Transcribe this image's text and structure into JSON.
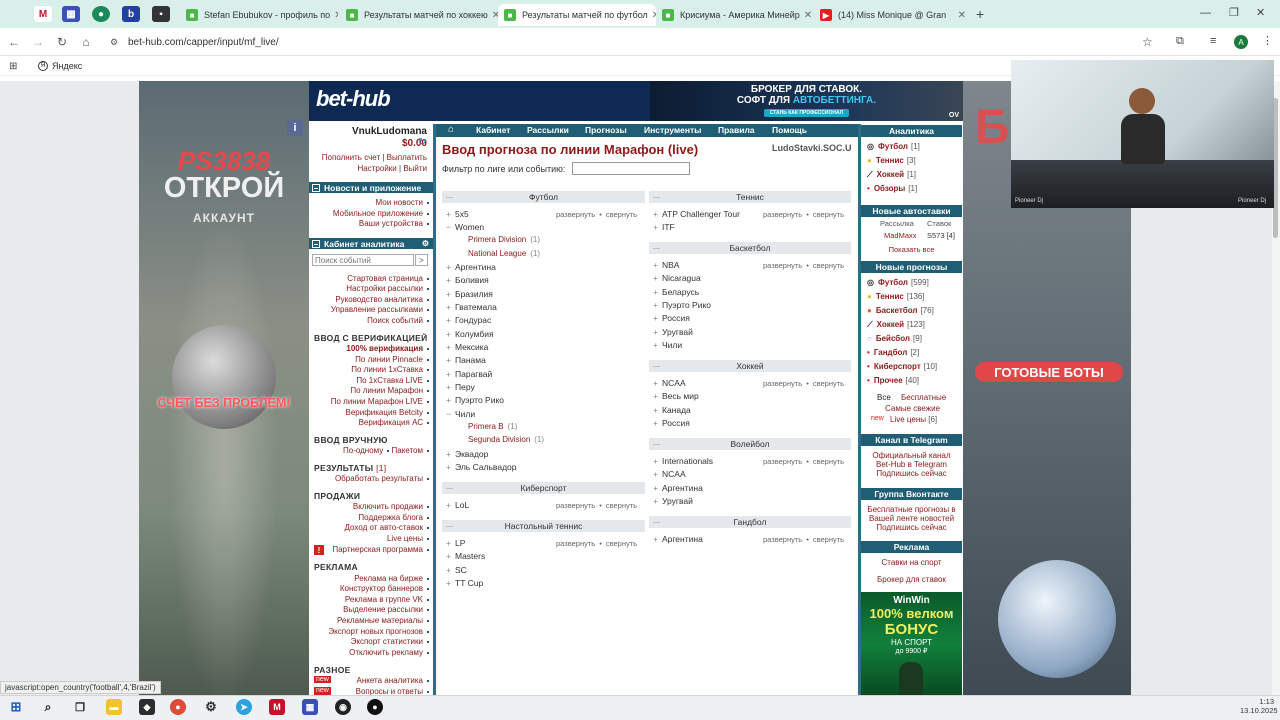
{
  "browser": {
    "pinned": [
      {
        "icon": "mail-ru-icon",
        "label": "M",
        "color": "#c8102e"
      },
      {
        "icon": "grid-app-icon",
        "label": "▦",
        "color": "#3a4fb8"
      },
      {
        "icon": "green-circle-icon",
        "label": "●",
        "color": "#1a8a5a"
      },
      {
        "icon": "b-app-icon",
        "label": "b",
        "color": "#2340a0"
      },
      {
        "icon": "dark-app-icon",
        "label": "▪",
        "color": "#333333"
      }
    ],
    "tabs": [
      {
        "title": "Stefan Ebubukov - профиль по",
        "active": false,
        "fav_color": "#4cb848"
      },
      {
        "title": "Результаты матчей по хоккею",
        "active": false,
        "fav_color": "#4cb848"
      },
      {
        "title": "Результаты матчей по футбол",
        "active": true,
        "fav_color": "#4cb848"
      },
      {
        "title": "Крисиума - Америка Минейр",
        "active": false,
        "fav_color": "#4cb848"
      },
      {
        "title": "(14) Miss Monique @ Gran",
        "active": false,
        "fav_color": "#e02020"
      }
    ],
    "url": "bet-hub.com/capper/input/mf_live/",
    "bookmark": "Яндекс",
    "profile_letter": "A"
  },
  "promo_left": {
    "brand": "PS3838",
    "open": "ОТКРОЙ",
    "account": "АККАУНТ",
    "slogan": "СЧЕТ БЕЗ ПРОБЛЕМ!"
  },
  "promo_right": {
    "letters": "Б",
    "bots": "ГОТОВЫЕ БОТЫ"
  },
  "header": {
    "logo": "bet-hub",
    "banner_line1": "БРОКЕР ДЛЯ СТАВОК.",
    "banner_line2": "СОФТ ДЛЯ",
    "banner_highlight": "АВТОБЕТТИНГА.",
    "banner_button": "СТАНЬ КАК ПРОФЕССИОНАЛ",
    "banner_corner": "OV"
  },
  "user": {
    "name": "VnukLudomana",
    "balance": "$0.00",
    "topup": "Пополнить счет",
    "withdraw": "Выплатить",
    "settings": "Настройки",
    "logout": "Выйти",
    "sep": "|"
  },
  "left": {
    "news_header": "Новости и приложение",
    "news_links": [
      "Мои новости",
      "Мобильное приложение",
      "Ваши устройства"
    ],
    "cabinet_header": "Кабинет аналитика",
    "search_placeholder": "Поиск событий",
    "cabinet_links": [
      "Стартовая страница",
      "Настройки рассылки",
      "Руководство аналитика",
      "Управление рассылками",
      "Поиск событий"
    ],
    "verif_title": "ВВОД С ВЕРИФИКАЦИЕЙ",
    "verif_links": [
      "100% верификация",
      "По линии Pinnacle",
      "По линии 1хСтавка",
      "По 1хСтавка LIVE",
      "По линии Марафон",
      "По линии Марафон LIVE",
      "Верификация Betcity",
      "Верификация АС"
    ],
    "manual_title": "ВВОД ВРУЧНУЮ",
    "manual_link1": "По-одному",
    "manual_link2": "Пакетом",
    "results_title": "РЕЗУЛЬТАТЫ",
    "results_count": "[1]",
    "results_link": "Обработать результаты",
    "sales_title": "ПРОДАЖИ",
    "sales_links": [
      "Включить продажи",
      "Поддержка блога",
      "Доход от авто-ставок",
      "Live цены",
      "Партнерская программа"
    ],
    "ads_title": "РЕКЛАМА",
    "ads_links": [
      "Реклама на бирже",
      "Конструктор баннеров",
      "Реклама в группе VK",
      "Выделение рассылки",
      "Рекламные материалы",
      "Экспорт новых прогнозов",
      "Экспорт статистики",
      "Отключить рекламу"
    ],
    "misc_title": "РАЗНОЕ",
    "misc_links": [
      "Анкета аналитика",
      "Вопросы и ответы"
    ],
    "new_badge": "new"
  },
  "nav": {
    "items": [
      "Кабинет",
      "Рассылки",
      "Прогнозы",
      "Инструменты",
      "Правила",
      "Помощь"
    ]
  },
  "content": {
    "title": "Ввод прогноза по линии Марафон (live)",
    "site": "LudoStavki.SOC.U",
    "filter_label": "Фильтр по лиге или событию:",
    "expand": "развернуть",
    "collapse": "свернуть",
    "bullet": "•",
    "football_header": "Футбол",
    "football": [
      {
        "name": "5х5",
        "sign": "+",
        "actions": true
      },
      {
        "name": "Women",
        "sign": "−",
        "actions": false
      },
      {
        "name": "Argентина",
        "sign": "+",
        "actions": false
      },
      {
        "name": "Боливия",
        "sign": "+",
        "actions": false
      },
      {
        "name": "Бразилия",
        "sign": "+",
        "actions": false
      },
      {
        "name": "Гватемала",
        "sign": "+",
        "actions": false
      },
      {
        "name": "Гондурас",
        "sign": "+",
        "actions": false
      },
      {
        "name": "Колумбия",
        "sign": "+",
        "actions": false
      },
      {
        "name": "Мексика",
        "sign": "+",
        "actions": false
      },
      {
        "name": "Панама",
        "sign": "+",
        "actions": false
      },
      {
        "name": "Парагвай",
        "sign": "+",
        "actions": false
      },
      {
        "name": "Перу",
        "sign": "+",
        "actions": false
      },
      {
        "name": "Пуэрто Рико",
        "sign": "+",
        "actions": false
      },
      {
        "name": "Чили",
        "sign": "−",
        "actions": false
      },
      {
        "name": "Эквадор",
        "sign": "+",
        "actions": false
      },
      {
        "name": "Эль Сальвадор",
        "sign": "+",
        "actions": false
      }
    ],
    "women_subs": [
      {
        "name": "Primera Division",
        "count": "(1)"
      },
      {
        "name": "National League",
        "count": "(1)"
      }
    ],
    "chile_subs": [
      {
        "name": "Primera B",
        "count": "(1)"
      },
      {
        "name": "Segunda Division",
        "count": "(1)"
      }
    ],
    "esports_header": "Киберспорт",
    "esports": [
      {
        "name": "LoL",
        "sign": "+"
      }
    ],
    "tabletennis_header": "Настольный теннис",
    "tabletennis": [
      {
        "name": "LP",
        "sign": "+"
      },
      {
        "name": "Masters",
        "sign": "+"
      },
      {
        "name": "SC",
        "sign": "+"
      },
      {
        "name": "TT Cup",
        "sign": "+"
      }
    ],
    "tennis_header": "Теннис",
    "tennis": [
      {
        "name": "ATP Challenger Tour",
        "sign": "+"
      },
      {
        "name": "ITF",
        "sign": "+"
      }
    ],
    "basketball_header": "Баскетбол",
    "basketball": [
      {
        "name": "NBA",
        "sign": "+"
      },
      {
        "name": "Nicaragua",
        "sign": "+"
      },
      {
        "name": "Беларусь",
        "sign": "+"
      },
      {
        "name": "Пуэрто Рико",
        "sign": "+"
      },
      {
        "name": "Россия",
        "sign": "+"
      },
      {
        "name": "Уругвай",
        "sign": "+"
      },
      {
        "name": "Чили",
        "sign": "+"
      }
    ],
    "hockey_header": "Хоккей",
    "hockey": [
      {
        "name": "NCAA",
        "sign": "+"
      },
      {
        "name": "Весь мир",
        "sign": "+"
      },
      {
        "name": "Канада",
        "sign": "+"
      },
      {
        "name": "Россия",
        "sign": "+"
      }
    ],
    "volleyball_header": "Волейбол",
    "volleyball": [
      {
        "name": "Internationals",
        "sign": "+"
      },
      {
        "name": "NCAA",
        "sign": "+"
      },
      {
        "name": "Аргентина",
        "sign": "+"
      },
      {
        "name": "Уругвай",
        "sign": "+"
      }
    ],
    "handball_header": "Гандбол",
    "handball": [
      {
        "name": "Аргентина",
        "sign": "+"
      }
    ]
  },
  "right": {
    "analytics_header": "Аналитика",
    "analytics": [
      {
        "name": "Футбол",
        "count": "[1]"
      },
      {
        "name": "Теннис",
        "count": "[3]"
      },
      {
        "name": "Хоккей",
        "count": "[1]"
      },
      {
        "name": "Обзоры",
        "count": "[1]"
      }
    ],
    "autobets_header": "Новые автоставки",
    "autobets_col1": "Рассылка",
    "autobets_col2": "Ставок",
    "autobets_row_name": "MadMaxx",
    "autobets_row_val": "S573 [4]",
    "show_all": "Показать все",
    "newpred_header": "Новые прогнозы",
    "newpred": [
      {
        "name": "Футбол",
        "count": "[599]"
      },
      {
        "name": "Теннис",
        "count": "[136]"
      },
      {
        "name": "Баскетбол",
        "count": "[76]"
      },
      {
        "name": "Хоккей",
        "count": "[123]"
      },
      {
        "name": "Бейсбол",
        "count": "[9]"
      },
      {
        "name": "Гандбол",
        "count": "[2]"
      },
      {
        "name": "Киберспорт",
        "count": "[10]"
      },
      {
        "name": "Прочее",
        "count": "[40]"
      }
    ],
    "all": "Все",
    "free": "Бесплатные",
    "hottest": "Самые свежие",
    "new": "new",
    "live_prices": "Live цены",
    "live_count": "[6]",
    "tg_header": "Канал в Telegram",
    "tg_links": [
      "Официальный канал",
      "Bet-Hub в Telegram",
      "Подпишись сейчас"
    ],
    "vk_header": "Группа Вконтакте",
    "vk_links": [
      "Бесплатные прогнозы в",
      "Вашей ленте новостей",
      "Подпишись сейчас"
    ],
    "ad_header": "Реклама",
    "ad_links": [
      "Ставки на спорт",
      "Брокер для ставок"
    ],
    "winwin_brand": "WinWin",
    "winwin_pct": "100% велком",
    "winwin_bonus": "БОНУС",
    "winwin_sport": "НА СПОРТ",
    "winwin_amount": "до 9900 ₽"
  },
  "status_bar": "javascript:open_country('football',4,'Brazil')",
  "taskbar": {
    "time": "1:13",
    "date": "13.10.2025"
  },
  "video": {
    "left_tag": "Pioneer Dj",
    "right_tag": "Pioneer Dj"
  }
}
